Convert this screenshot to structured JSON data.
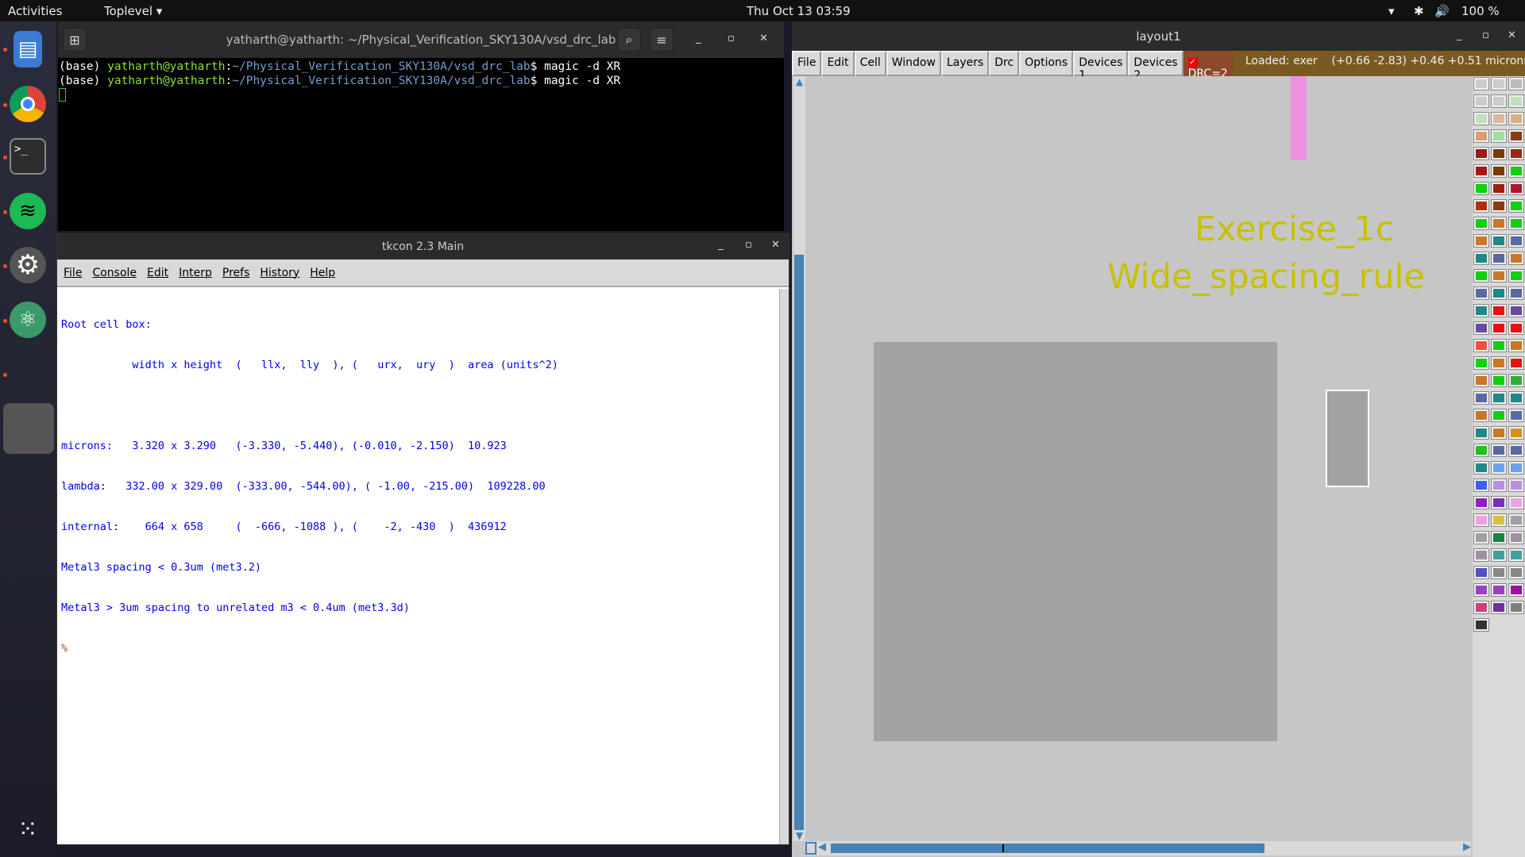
{
  "topbar": {
    "activities": "Activities",
    "app_menu": "Toplevel ▾",
    "clock": "Thu Oct 13  03:59",
    "battery": "100 %"
  },
  "dock": {
    "items": [
      "files",
      "chrome",
      "terminal",
      "spotify",
      "settings",
      "atom",
      "active-app",
      "show-applications"
    ]
  },
  "terminal": {
    "title": "yatharth@yatharth: ~/Physical_Verification_SKY130A/vsd_drc_lab",
    "lines": [
      {
        "prefix": "(base) ",
        "user": "yatharth@yatharth",
        "path": "~/Physical_Verification_SKY130A/vsd_drc_lab",
        "cmd": "$ magic -d XR"
      },
      {
        "prefix": "(base) ",
        "user": "yatharth@yatharth",
        "path": "~/Physical_Verification_SKY130A/vsd_drc_lab",
        "cmd": "$ magic -d XR"
      }
    ]
  },
  "tkcon": {
    "title": "tkcon 2.3 Main",
    "menu": [
      "File",
      "Console",
      "Edit",
      "Interp",
      "Prefs",
      "History",
      "Help"
    ],
    "output": [
      "Root cell box:",
      "           width x height  (   llx,  lly  ), (   urx,  ury  )  area (units^2)",
      "",
      "microns:   3.320 x 3.290   (-3.330, -5.440), (-0.010, -2.150)  10.923",
      "lambda:   332.00 x 329.00  (-333.00, -544.00), ( -1.00, -215.00)  109228.00",
      "internal:    664 x 658     (  -666, -1088 ), (    -2, -430  )  436912",
      "Metal3 spacing < 0.3um (met3.2)",
      "Metal3 > 3um spacing to unrelated m3 < 0.4um (met3.3d)"
    ],
    "prompt": "%"
  },
  "layout": {
    "title": "layout1",
    "menu": [
      "File",
      "Edit",
      "Cell",
      "Window",
      "Layers",
      "Drc",
      "Options",
      "Devices 1",
      "Devices 2"
    ],
    "drc": "DRC=2",
    "loaded": "Loaded: exer",
    "coords": "(+0.66 -2.83) +0.46 +0.51 microns",
    "labels": [
      "Exercise_1c",
      "Wide_spacing_rule"
    ],
    "label_color": "#c8c000",
    "hscroll_fraction": 0.7,
    "palette": [
      "#ccc",
      "#ccc",
      "#bbb",
      "#ccc",
      "#ccc",
      "#bfe0bf",
      "#bfe0bf",
      "#d8b8a0",
      "#d8b080",
      "#d8a070",
      "#a0e0a0",
      "#8b3a10",
      "#a01818",
      "#7a3a08",
      "#9a2a10",
      "#a01818",
      "#7a3a08",
      "#10d010",
      "#10d010",
      "#a02010",
      "#b01830",
      "#b03010",
      "#8b3a10",
      "#10d010",
      "#10d010",
      "#c87828",
      "#10d010",
      "#c87828",
      "#208888",
      "#5a6aa0",
      "#208888",
      "#5a6aa0",
      "#c87828",
      "#10d010",
      "#c87828",
      "#10d010",
      "#5a6aa0",
      "#208888",
      "#5a6aa0",
      "#208888",
      "#e81010",
      "#6a4aa0",
      "#6a4aa0",
      "#e81010",
      "#e81010",
      "#f05040",
      "#10d010",
      "#c87828",
      "#10d010",
      "#c87828",
      "#e81010",
      "#c87828",
      "#10d010",
      "#30b030",
      "#5a6aa0",
      "#208888",
      "#208888",
      "#c87828",
      "#10d010",
      "#5a6aa0",
      "#208888",
      "#c87828",
      "#d89020",
      "#20c020",
      "#5a6aa0",
      "#5a6aa0",
      "#208888",
      "#6aa0f0",
      "#6aa0f0",
      "#4060f0",
      "#b890e0",
      "#b890e0",
      "#9020c0",
      "#7a30b0",
      "#f0a0e0",
      "#f0a0e0",
      "#d8c040",
      "#a0a0a0",
      "#a0a0a0",
      "#208040",
      "#a090a0",
      "#a090a0",
      "#40a0a0",
      "#40a0a0",
      "#5050c0",
      "#888888",
      "#888888",
      "#9a40c0",
      "#9a40c0",
      "#a010a0",
      "#d04080",
      "#7030a0",
      "#808080",
      "#333333"
    ]
  }
}
